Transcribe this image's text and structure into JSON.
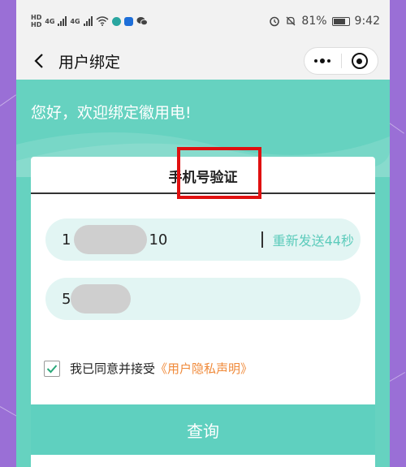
{
  "status_bar": {
    "left_labels": [
      "HD",
      "HD"
    ],
    "net_label_1": "4G",
    "net_label_2": "4G",
    "battery_percent": "81%",
    "time": "9:42"
  },
  "nav": {
    "title": "用户绑定"
  },
  "header": {
    "greeting": "您好，欢迎绑定徽用电!"
  },
  "card": {
    "title": "手机号验证",
    "phone_prefix": "1",
    "phone_suffix": "10",
    "resend_label": "重新发送44秒",
    "code_prefix": "5",
    "agree_text": "我已同意并接受",
    "policy_link": "《用户隐私声明》",
    "agree_checked": true,
    "submit_label": "查询"
  },
  "colors": {
    "teal": "#66d2c0",
    "accent_text": "#5ccbbb",
    "link_orange": "#f08a3a",
    "highlight_red": "#e01010",
    "frame_purple": "#9a6fd6"
  }
}
